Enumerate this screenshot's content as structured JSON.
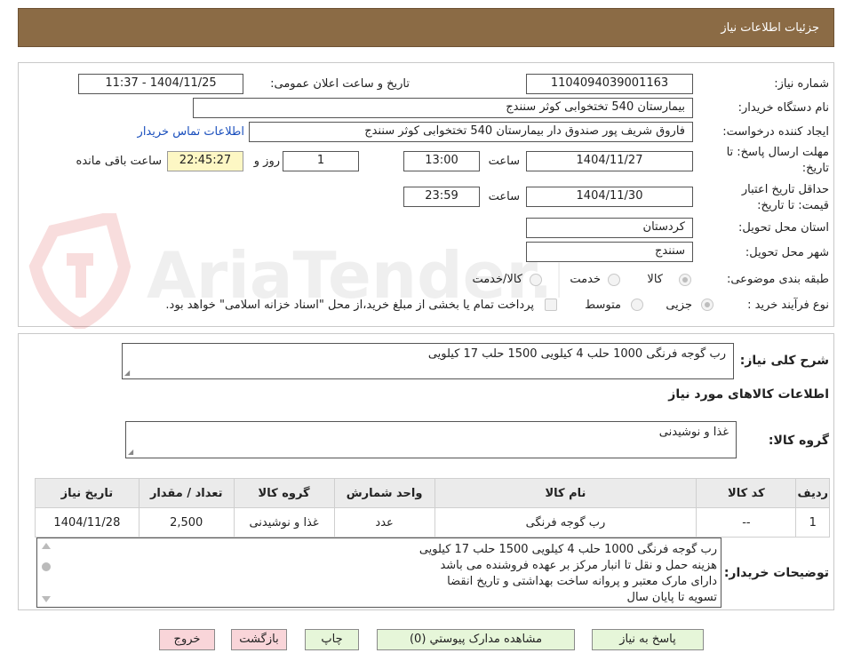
{
  "header": {
    "title": "جزئیات اطلاعات نیاز"
  },
  "form": {
    "need_number_label": "شماره نیاز:",
    "need_number": "1104094039001163",
    "announce_label": "تاریخ و ساعت اعلان عمومی:",
    "announce_value": "1404/11/25 - 11:37",
    "buyer_org_label": "نام دستگاه خریدار:",
    "buyer_org": "بیمارستان 540 تختخوابی کوثر سنندج",
    "creator_label": "ایجاد کننده درخواست:",
    "creator": "فاروق شریف پور صندوق دار بیمارستان 540 تختخوابی کوثر سنندج",
    "contact_link": "اطلاعات تماس خریدار",
    "deadline_label_1": "مهلت ارسال پاسخ: تا",
    "deadline_label_2": "تاریخ:",
    "deadline_date": "1404/11/27",
    "time_label": "ساعت",
    "deadline_time": "13:00",
    "days_value": "1",
    "days_label": "روز و",
    "remaining_time": "22:45:27",
    "remaining_label": "ساعت باقی مانده",
    "validity_label_1": "حداقل تاریخ اعتبار",
    "validity_label_2": "قیمت: تا تاریخ:",
    "validity_date": "1404/11/30",
    "validity_time_label": "ساعت",
    "validity_time": "23:59",
    "province_label": "استان محل تحویل:",
    "province": "کردستان",
    "city_label": "شهر محل تحویل:",
    "city": "سنندج",
    "category_label": "طبقه بندی موضوعی:",
    "category_options": [
      "کالا",
      "خدمت",
      "کالا/خدمت"
    ],
    "process_label": "نوع فرآیند خرید :",
    "process_options": [
      "جزیی",
      "متوسط"
    ],
    "payment_note": "پرداخت تمام یا بخشی از مبلغ خرید،از محل \"اسناد خزانه اسلامی\" خواهد بود."
  },
  "summary": {
    "desc_label": "شرح کلی نیاز:",
    "desc_value": "رب گوجه فرنگی 1000 حلب 4 کیلویی 1500 حلب 17 کیلویی",
    "goods_info_heading": "اطلاعات کالاهای مورد نیاز",
    "group_label": "گروه کالا:",
    "group_value": "غذا و نوشیدنی"
  },
  "table": {
    "headers": [
      "ردیف",
      "کد کالا",
      "نام کالا",
      "واحد شمارش",
      "گروه کالا",
      "تعداد / مقدار",
      "تاریخ نیاز"
    ],
    "rows": [
      [
        "1",
        "--",
        "رب گوجه فرنگی",
        "عدد",
        "غذا و نوشیدنی",
        "2,500",
        "1404/11/28"
      ]
    ]
  },
  "notes": {
    "label": "توضیحات خریدار:",
    "lines": [
      "رب گوجه فرنگی 1000 حلب 4 کیلویی 1500 حلب 17 کیلویی",
      "هزینه حمل و نقل تا انبار مرکز بر عهده فروشنده  می باشد",
      "دارای مارک معتبر و پروانه ساخت بهداشتی و تاریخ انقضا",
      "تسویه تا پایان سال"
    ]
  },
  "buttons": {
    "reply": "پاسخ به نیاز",
    "attachments": "مشاهده مدارک پیوستي (0)",
    "print": "چاپ",
    "back": "بازگشت",
    "exit": "خروج"
  },
  "watermark": {
    "text": "AriaTender.neT"
  }
}
